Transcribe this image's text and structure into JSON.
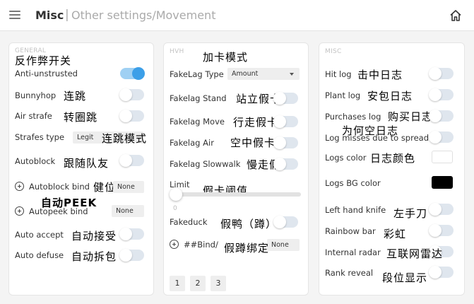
{
  "header": {
    "title": "Misc",
    "separator": "|",
    "breadcrumb": "Other settings/Movement"
  },
  "colors": {
    "accent": "#3c9fe8",
    "toggle_on_track": "#9fd0f3",
    "toggle_off_track": "#dfe6ee",
    "logs_color": "#ffffff",
    "logs_bg_color": "#000000"
  },
  "general": {
    "title": "GENERAL",
    "title_zh": "反作弊开关",
    "anti_unstrusted": {
      "label": "Anti-unstrusted",
      "on": true
    },
    "bunnyhop": {
      "label": "Bunnyhop",
      "zh": "连跳",
      "on": false
    },
    "air_strafe": {
      "label": "Air strafe",
      "zh": "转圈跳",
      "on": false
    },
    "strafes_type": {
      "label": "Strafes type",
      "value": "Legit",
      "zh": "连跳模式"
    },
    "autoblock": {
      "label": "Autoblock",
      "zh": "跟随队友",
      "on": false
    },
    "autoblock_bind": {
      "label": "Autoblock bind",
      "zh": "健位",
      "value": "None"
    },
    "autopeek_zh": "自动PEEK",
    "autopeek_bind": {
      "label": "Autopeek bind",
      "value": "None"
    },
    "auto_accept": {
      "label": "Auto accept",
      "zh": "自动接受",
      "on": false
    },
    "auto_defuse": {
      "label": "Auto defuse",
      "zh": "自动拆包",
      "on": false
    }
  },
  "hvh": {
    "title": "HVH",
    "title_zh": "加卡模式",
    "fakelag_type": {
      "label": "FakeLag Type",
      "value": "Amount"
    },
    "fakelag_stand": {
      "label": "Fakelag Stand",
      "zh": "站立假卡",
      "on": false
    },
    "fakelag_move": {
      "label": "Fakelag Move",
      "zh": "行走假卡",
      "on": false
    },
    "fakelag_air": {
      "label": "Fakelag Air",
      "zh": "空中假卡",
      "on": false
    },
    "fakelag_slowwalk": {
      "label": "Fakelag Slowwalk",
      "zh": "慢走假卡",
      "on": false
    },
    "limit": {
      "label": "Limit",
      "zh": "假卡阈值",
      "value": "0",
      "fraction": 0
    },
    "fakeduck": {
      "label": "Fakeduck",
      "zh": "假鸭（蹲）",
      "on": false
    },
    "bind": {
      "label": "##Bind/",
      "zh": "假蹲绑定",
      "value": "None"
    },
    "pages": [
      "1",
      "2",
      "3"
    ]
  },
  "misc": {
    "title": "MISC",
    "hit_log": {
      "label": "Hit log",
      "zh": "击中日志",
      "on": false
    },
    "plant_log": {
      "label": "Plant log",
      "zh": "安包日志",
      "on": false
    },
    "purchases_log": {
      "label": "Purchases log",
      "zh": "购买日志",
      "on": false
    },
    "why_empty_zh": "为何空日志",
    "log_misses": {
      "label": "Log misses due to spread",
      "on": false
    },
    "logs_color": {
      "label": "Logs color",
      "zh": "日志颜色"
    },
    "logs_bg_color": {
      "label": "Logs BG color"
    },
    "left_hand_knife": {
      "label": "Left hand knife",
      "zh": "左手刀",
      "on": false
    },
    "rainbow_bar": {
      "label": "Rainbow bar",
      "zh": "彩虹",
      "on": false
    },
    "internal_radar": {
      "label": "Internal radar",
      "zh": "互联网雷达",
      "on": false
    },
    "rank_reveal": {
      "label": "Rank reveal",
      "zh": "段位显示",
      "on": false
    }
  }
}
